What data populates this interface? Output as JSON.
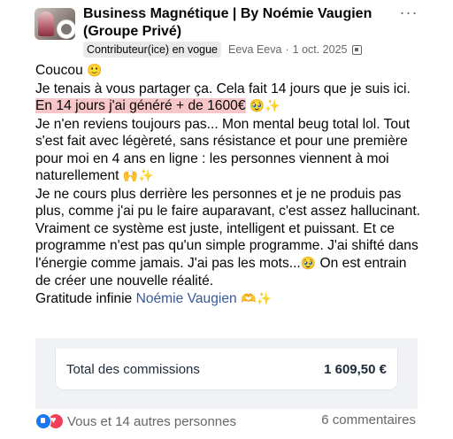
{
  "header": {
    "group_name": "Business Magnétique | By Noémie Vaugien (Groupe Privé)",
    "badge": "Contributeur(ice) en vogue",
    "author": "Eeva Eeva",
    "separator": "·",
    "date": "1 oct. 2025",
    "more_icon": "···"
  },
  "post": {
    "lines": [
      {
        "text": "Coucou ",
        "emoji": "🙂"
      },
      {
        "text": "Je tenais à vous partager ça. Cela fait 14 jours que je suis ici."
      },
      {
        "highlight": "En 14 jours j'ai généré + de 1600€",
        "emoji": "🥹✨"
      },
      {
        "text": "Je n'en reviens toujours pas... Mon mental beug total lol. Tout s'est fait avec légèreté, sans résistance et pour une première pour moi en 4 ans en ligne : les personnes viennent à moi naturellement ",
        "emoji": "🙌✨"
      },
      {
        "text": "Je ne cours plus derrière les personnes et je ne produis pas plus, comme j'ai pu le faire auparavant, c'est assez hallucinant."
      },
      {
        "text": "Vraiment ce système est juste, intelligent et puissant. Et ce programme n'est pas qu'un simple programme. J'ai shifté dans l'énergie comme jamais. J'ai pas les mots...",
        "emoji": "🥹",
        "text2": " On est entrain de créer une nouvelle réalité."
      },
      {
        "text": "Gratitude infinie ",
        "mention": "Noémie Vaugien",
        "emoji": " 🫶✨"
      }
    ]
  },
  "commission": {
    "label": "Total des commissions",
    "value": "1 609,50 €"
  },
  "footer": {
    "reactions_text": "Vous et 14 autres personnes",
    "comments": "6 commentaires"
  }
}
